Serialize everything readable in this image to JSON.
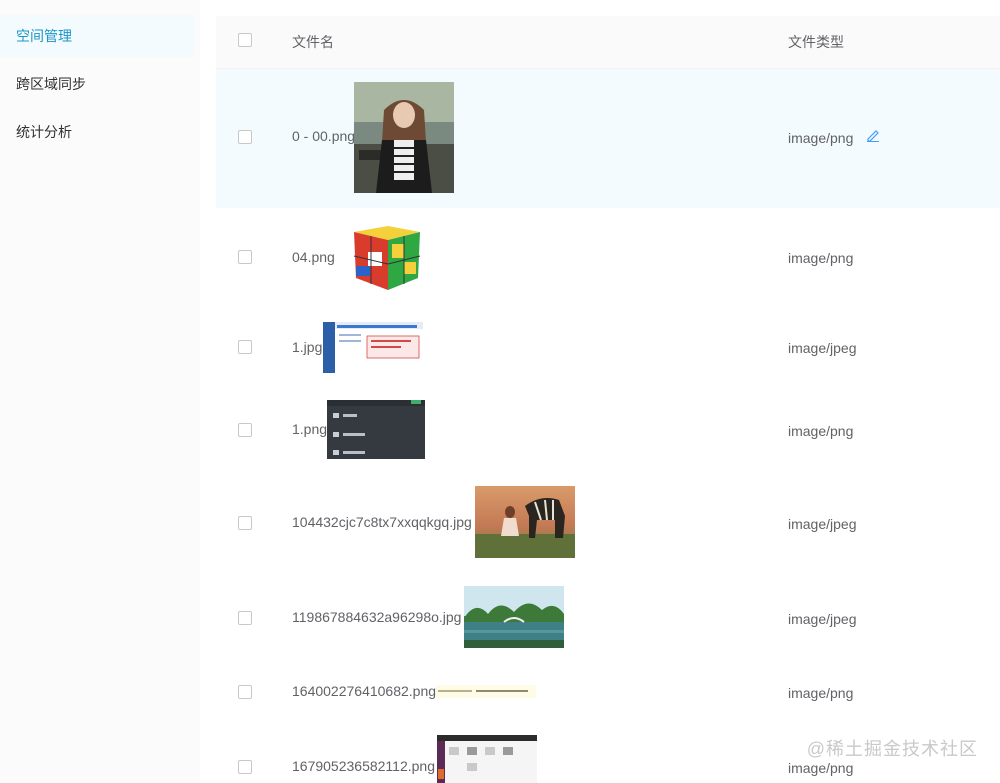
{
  "sidebar": {
    "items": [
      {
        "label": "空间管理",
        "active": true
      },
      {
        "label": "跨区域同步",
        "active": false
      },
      {
        "label": "统计分析",
        "active": false
      }
    ]
  },
  "table": {
    "columns": {
      "name": "文件名",
      "type": "文件类型"
    },
    "rows": [
      {
        "name": "0 - 00.png",
        "type": "image/png",
        "thumb": "photo-portrait"
      },
      {
        "name": "04.png",
        "type": "image/png",
        "thumb": "rubiks-cube"
      },
      {
        "name": "1.jpg",
        "type": "image/jpeg",
        "thumb": "webpage-screenshot"
      },
      {
        "name": "1.png",
        "type": "image/png",
        "thumb": "dark-menu-screenshot"
      },
      {
        "name": "104432cjc7c8tx7xxqqkgq.jpg",
        "type": "image/jpeg",
        "thumb": "girl-with-zebra"
      },
      {
        "name": "119867884632a96298o.jpg",
        "type": "image/jpeg",
        "thumb": "lake-landscape"
      },
      {
        "name": "164002276410682.png",
        "type": "image/png",
        "thumb": "text-banner"
      },
      {
        "name": "167905236582112.png",
        "type": "image/png",
        "thumb": "desktop-screenshot"
      }
    ]
  },
  "icons": {
    "edit": "edit-pencil-icon"
  },
  "colors": {
    "accent": "#1b95c7",
    "hover_row": "#f4fbff",
    "link": "#409eff"
  },
  "watermark": "@稀土掘金技术社区"
}
